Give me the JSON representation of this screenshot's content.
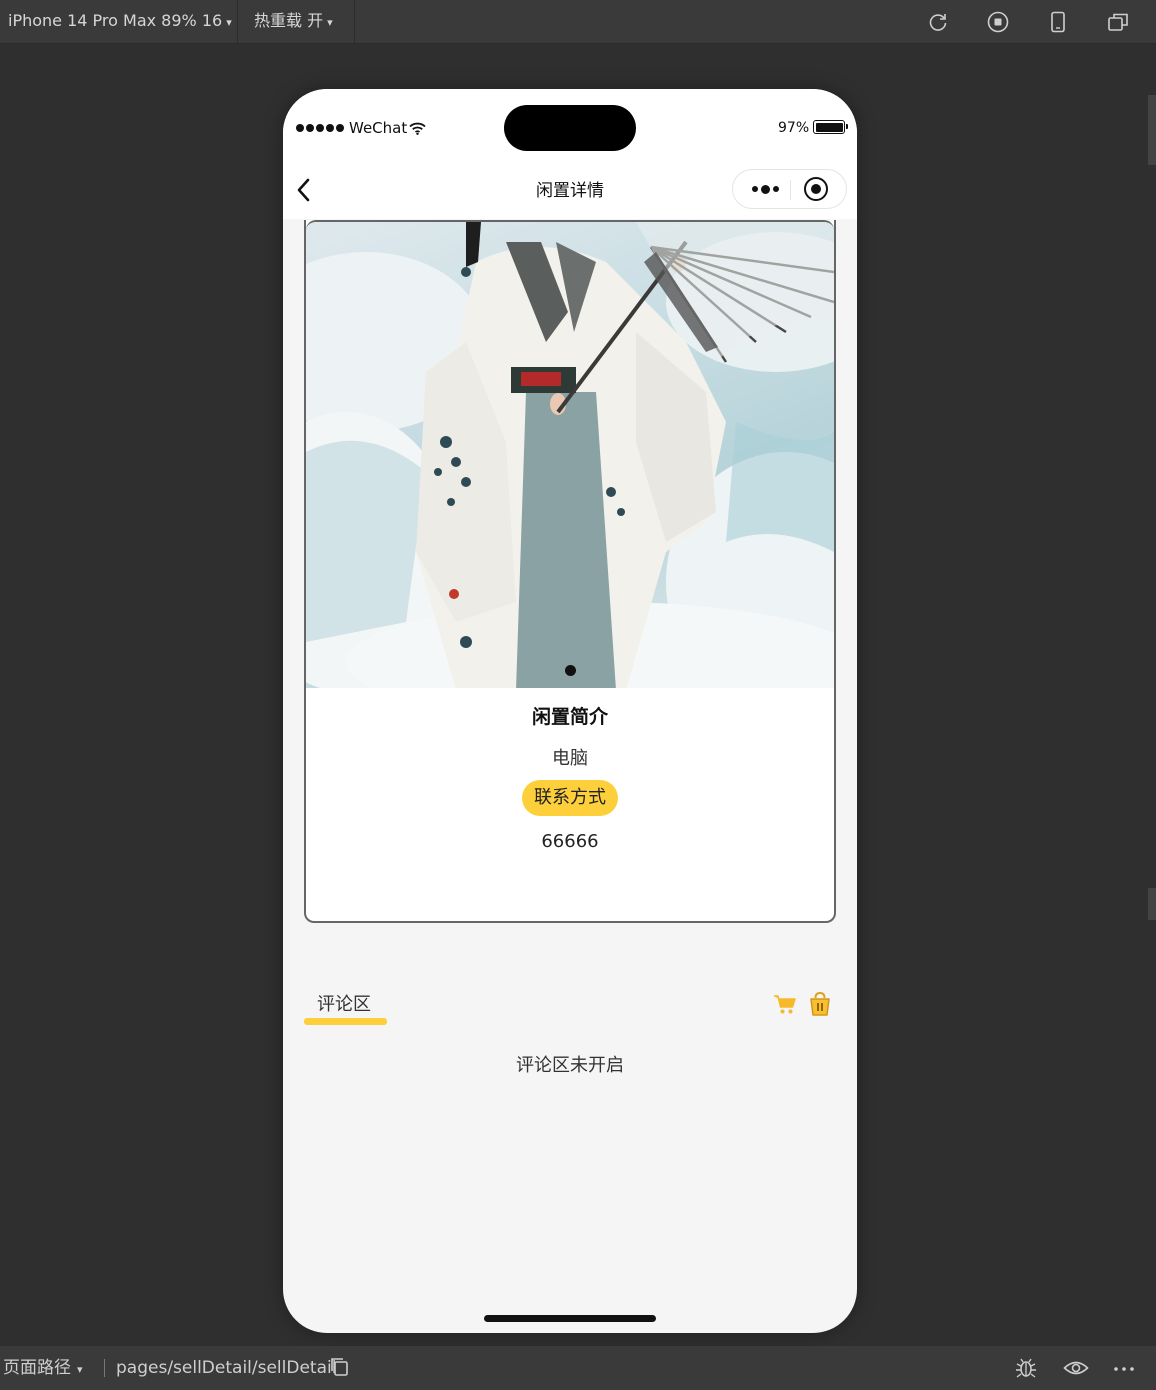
{
  "toolbar": {
    "device_label": "iPhone 14 Pro Max 89% 16",
    "hot_reload_label": "热重载 开",
    "caret": "▾",
    "icons": [
      "refresh-icon",
      "stop-icon",
      "phone-icon",
      "window-icon"
    ]
  },
  "status_bar": {
    "carrier": "WeChat",
    "battery": "97%"
  },
  "nav": {
    "title": "闲置详情"
  },
  "detail": {
    "intro_title": "闲置简介",
    "intro_text": "电脑",
    "contact_label": "联系方式",
    "contact_value": "66666",
    "accent": "#fdd03b"
  },
  "comments": {
    "tab_label": "评论区",
    "empty_text": "评论区未开启"
  },
  "bottom_bar": {
    "path_label": "页面路径",
    "caret": "▾",
    "page_path": "pages/sellDetail/sellDetail"
  }
}
